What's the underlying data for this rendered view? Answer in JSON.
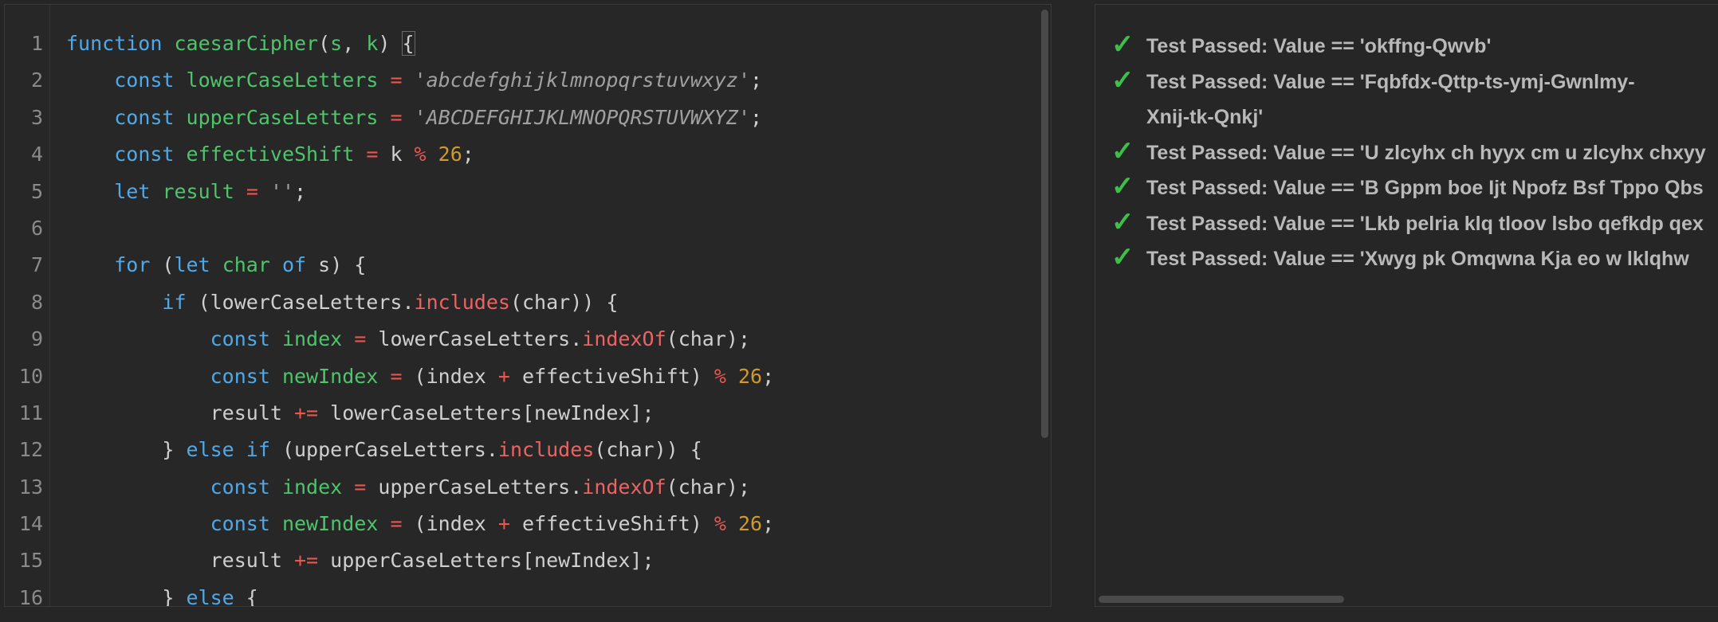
{
  "editor": {
    "lines": [
      {
        "n": "1",
        "parts": [
          [
            "kw",
            "function"
          ],
          [
            "id",
            " "
          ],
          [
            "fn",
            "caesarCipher"
          ],
          [
            "id",
            "("
          ],
          [
            "fn",
            "s"
          ],
          [
            "id",
            ", "
          ],
          [
            "fn",
            "k"
          ],
          [
            "id",
            ") "
          ],
          [
            "brk",
            "{"
          ]
        ]
      },
      {
        "n": "2",
        "parts": [
          [
            "id",
            "    "
          ],
          [
            "kw",
            "const"
          ],
          [
            "id",
            " "
          ],
          [
            "fn",
            "lowerCaseLetters"
          ],
          [
            "id",
            " "
          ],
          [
            "op",
            "="
          ],
          [
            "id",
            " "
          ],
          [
            "str",
            "'abcdefghijklmnopqrstuvwxyz'"
          ],
          [
            "id",
            ";"
          ]
        ]
      },
      {
        "n": "3",
        "parts": [
          [
            "id",
            "    "
          ],
          [
            "kw",
            "const"
          ],
          [
            "id",
            " "
          ],
          [
            "fn",
            "upperCaseLetters"
          ],
          [
            "id",
            " "
          ],
          [
            "op",
            "="
          ],
          [
            "id",
            " "
          ],
          [
            "str",
            "'ABCDEFGHIJKLMNOPQRSTUVWXYZ'"
          ],
          [
            "id",
            ";"
          ]
        ]
      },
      {
        "n": "4",
        "parts": [
          [
            "id",
            "    "
          ],
          [
            "kw",
            "const"
          ],
          [
            "id",
            " "
          ],
          [
            "fn",
            "effectiveShift"
          ],
          [
            "id",
            " "
          ],
          [
            "op",
            "="
          ],
          [
            "id",
            " k "
          ],
          [
            "op",
            "%"
          ],
          [
            "id",
            " "
          ],
          [
            "num",
            "26"
          ],
          [
            "id",
            ";"
          ]
        ]
      },
      {
        "n": "5",
        "parts": [
          [
            "id",
            "    "
          ],
          [
            "kw",
            "let"
          ],
          [
            "id",
            " "
          ],
          [
            "fn",
            "result"
          ],
          [
            "id",
            " "
          ],
          [
            "op",
            "="
          ],
          [
            "id",
            " "
          ],
          [
            "str",
            "''"
          ],
          [
            "id",
            ";"
          ]
        ]
      },
      {
        "n": "6",
        "parts": []
      },
      {
        "n": "7",
        "parts": [
          [
            "id",
            "    "
          ],
          [
            "kw",
            "for"
          ],
          [
            "id",
            " ("
          ],
          [
            "kw",
            "let"
          ],
          [
            "id",
            " "
          ],
          [
            "fn",
            "char"
          ],
          [
            "id",
            " "
          ],
          [
            "kw",
            "of"
          ],
          [
            "id",
            " s) {"
          ]
        ]
      },
      {
        "n": "8",
        "parts": [
          [
            "id",
            "        "
          ],
          [
            "kw",
            "if"
          ],
          [
            "id",
            " (lowerCaseLetters."
          ],
          [
            "mth",
            "includes"
          ],
          [
            "id",
            "(char)) {"
          ]
        ]
      },
      {
        "n": "9",
        "parts": [
          [
            "id",
            "            "
          ],
          [
            "kw",
            "const"
          ],
          [
            "id",
            " "
          ],
          [
            "fn",
            "index"
          ],
          [
            "id",
            " "
          ],
          [
            "op",
            "="
          ],
          [
            "id",
            " lowerCaseLetters."
          ],
          [
            "mth",
            "indexOf"
          ],
          [
            "id",
            "(char);"
          ]
        ]
      },
      {
        "n": "10",
        "parts": [
          [
            "id",
            "            "
          ],
          [
            "kw",
            "const"
          ],
          [
            "id",
            " "
          ],
          [
            "fn",
            "newIndex"
          ],
          [
            "id",
            " "
          ],
          [
            "op",
            "="
          ],
          [
            "id",
            " (index "
          ],
          [
            "op",
            "+"
          ],
          [
            "id",
            " effectiveShift) "
          ],
          [
            "op",
            "%"
          ],
          [
            "id",
            " "
          ],
          [
            "num",
            "26"
          ],
          [
            "id",
            ";"
          ]
        ]
      },
      {
        "n": "11",
        "parts": [
          [
            "id",
            "            result "
          ],
          [
            "op",
            "+="
          ],
          [
            "id",
            " lowerCaseLetters[newIndex];"
          ]
        ]
      },
      {
        "n": "12",
        "parts": [
          [
            "id",
            "        } "
          ],
          [
            "kw",
            "else"
          ],
          [
            "id",
            " "
          ],
          [
            "kw",
            "if"
          ],
          [
            "id",
            " (upperCaseLetters."
          ],
          [
            "mth",
            "includes"
          ],
          [
            "id",
            "(char)) {"
          ]
        ]
      },
      {
        "n": "13",
        "parts": [
          [
            "id",
            "            "
          ],
          [
            "kw",
            "const"
          ],
          [
            "id",
            " "
          ],
          [
            "fn",
            "index"
          ],
          [
            "id",
            " "
          ],
          [
            "op",
            "="
          ],
          [
            "id",
            " upperCaseLetters."
          ],
          [
            "mth",
            "indexOf"
          ],
          [
            "id",
            "(char);"
          ]
        ]
      },
      {
        "n": "14",
        "parts": [
          [
            "id",
            "            "
          ],
          [
            "kw",
            "const"
          ],
          [
            "id",
            " "
          ],
          [
            "fn",
            "newIndex"
          ],
          [
            "id",
            " "
          ],
          [
            "op",
            "="
          ],
          [
            "id",
            " (index "
          ],
          [
            "op",
            "+"
          ],
          [
            "id",
            " effectiveShift) "
          ],
          [
            "op",
            "%"
          ],
          [
            "id",
            " "
          ],
          [
            "num",
            "26"
          ],
          [
            "id",
            ";"
          ]
        ]
      },
      {
        "n": "15",
        "parts": [
          [
            "id",
            "            result "
          ],
          [
            "op",
            "+="
          ],
          [
            "id",
            " upperCaseLetters[newIndex];"
          ]
        ]
      },
      {
        "n": "16",
        "parts": [
          [
            "id",
            "        } "
          ],
          [
            "kw",
            "else"
          ],
          [
            "id",
            " {"
          ]
        ]
      }
    ]
  },
  "colors": {
    "keyword": "#4fa9e8",
    "identifier_decl": "#4ec46b",
    "string": "#a0a0a0",
    "operator": "#e8564f",
    "number": "#d19a2a",
    "method": "#ec6363",
    "pass_check": "#3dbf4a"
  },
  "output": {
    "check_icon": "✓",
    "results": [
      {
        "text": "Test Passed: Value == 'okffng-Qwvb'",
        "wrap": false
      },
      {
        "text": "Test Passed: Value == 'Fqbfdx-Qttp-ts-ymj-Gwnlmy-Xnij-tk-Qnkj'",
        "wrap": true
      },
      {
        "text": "Test Passed: Value == 'U zlcyhx ch hyyx cm u zlcyhx chxyy",
        "wrap": false
      },
      {
        "text": "Test Passed: Value == 'B Gppm boe Ijt Npofz Bsf Tppo Qbs",
        "wrap": false
      },
      {
        "text": "Test Passed: Value == 'Lkb pelria klq tloov lsbo qefkdp qex",
        "wrap": false
      },
      {
        "text": "Test Passed: Value == 'Xwyg pk Omqwna Kja eo w lklqhw",
        "wrap": false
      }
    ]
  }
}
